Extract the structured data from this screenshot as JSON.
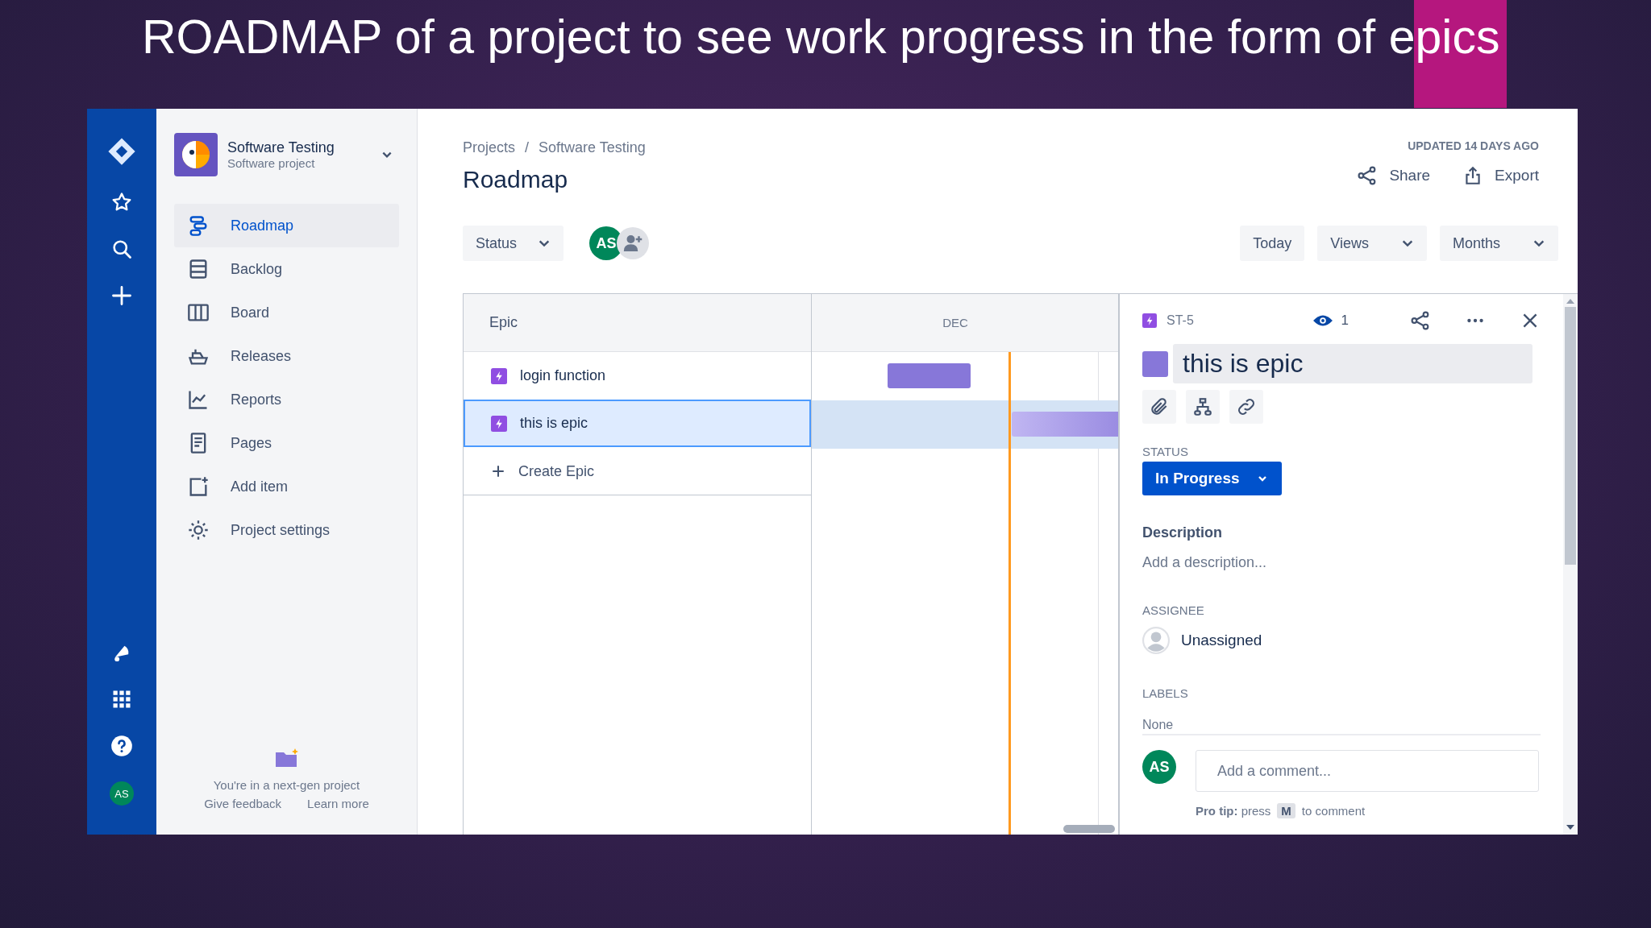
{
  "slide": {
    "title": "ROADMAP of a project to see work progress in the form of epics"
  },
  "nav_rail": {
    "avatar": "AS"
  },
  "sidebar": {
    "project_name": "Software Testing",
    "project_type": "Software project",
    "items": [
      {
        "label": "Roadmap",
        "selected": true
      },
      {
        "label": "Backlog",
        "selected": false
      },
      {
        "label": "Board",
        "selected": false
      },
      {
        "label": "Releases",
        "selected": false
      },
      {
        "label": "Reports",
        "selected": false
      },
      {
        "label": "Pages",
        "selected": false
      },
      {
        "label": "Add item",
        "selected": false
      },
      {
        "label": "Project settings",
        "selected": false
      }
    ],
    "footer": {
      "text": "You're in a next-gen project",
      "links": [
        "Give feedback",
        "Learn more"
      ]
    }
  },
  "header": {
    "breadcrumbs": [
      "Projects",
      "Software Testing"
    ],
    "separator": "/",
    "title": "Roadmap",
    "updated": "UPDATED 14 DAYS AGO",
    "actions": [
      "Share",
      "Export"
    ]
  },
  "toolbar": {
    "filter": "Status",
    "avatar": "AS",
    "buttons": [
      {
        "label": "Today",
        "kind": "button"
      },
      {
        "label": "Views",
        "kind": "dropdown"
      },
      {
        "label": "Months",
        "kind": "dropdown"
      }
    ]
  },
  "roadmap": {
    "column_header": "Epic",
    "month": "DEC",
    "epics": [
      {
        "name": "login function",
        "selected": false
      },
      {
        "name": "this is epic",
        "selected": true
      }
    ],
    "create_label": "Create Epic"
  },
  "detail": {
    "key": "ST-5",
    "watchers": "1",
    "title": "this is epic",
    "status_label": "STATUS",
    "status": "In Progress",
    "description_label": "Description",
    "description_placeholder": "Add a description...",
    "assignee_label": "ASSIGNEE",
    "assignee": "Unassigned",
    "labels_label": "LABELS",
    "labels": "None",
    "comment_avatar": "AS",
    "comment_placeholder": "Add a comment...",
    "pro_tip": "**Pro tip:** press",
    "pro_tip_key": "M",
    "pro_tip_end": "to comment"
  }
}
